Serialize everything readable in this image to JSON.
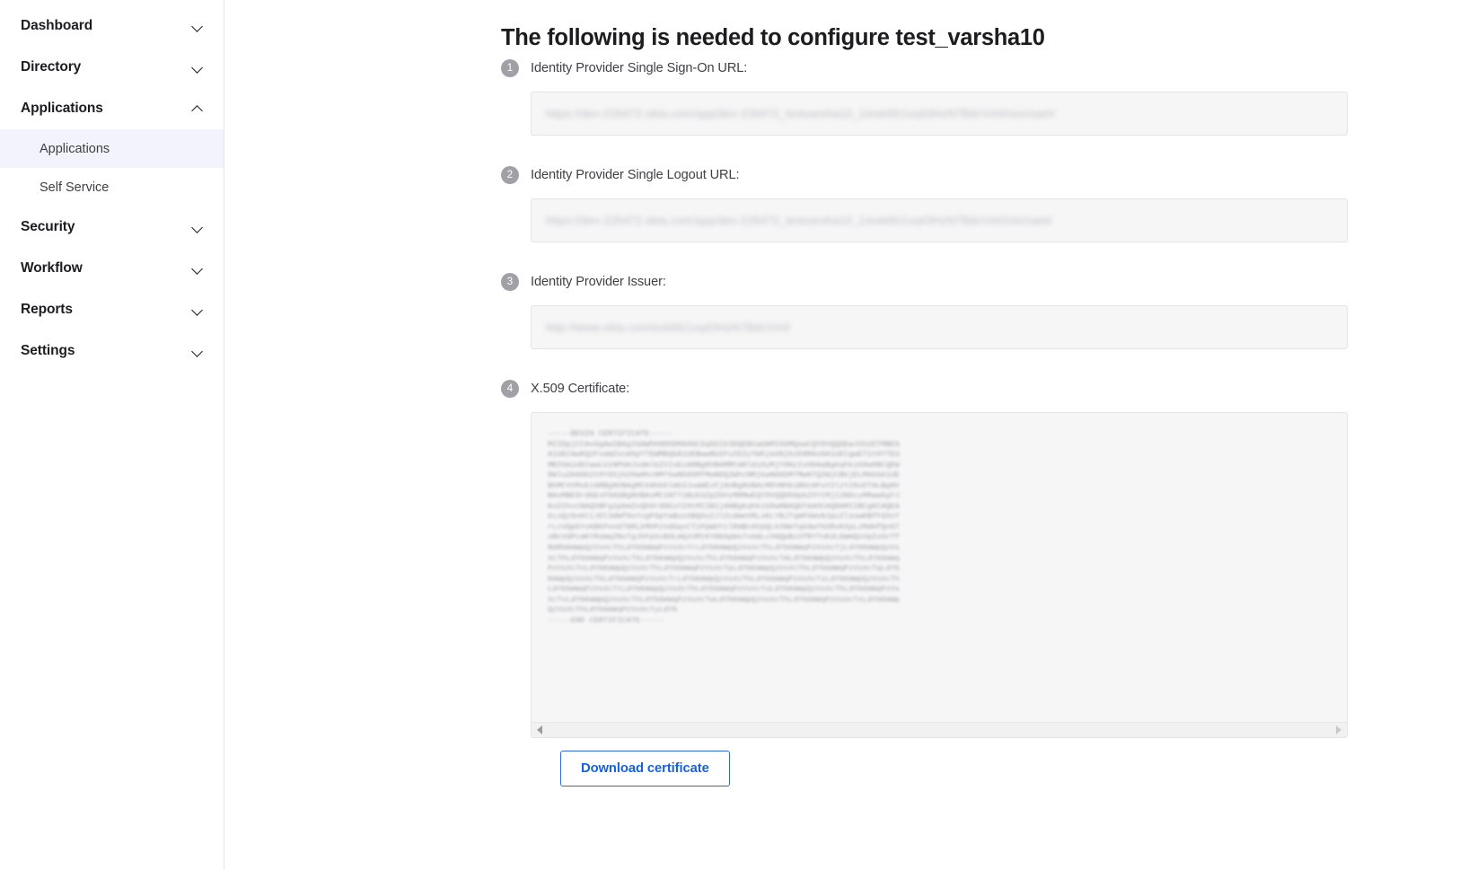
{
  "sidebar": {
    "groups": [
      {
        "label": "Dashboard",
        "icon": "chevron-down-icon",
        "expanded": false,
        "items": []
      },
      {
        "label": "Directory",
        "icon": "chevron-down-icon",
        "expanded": false,
        "items": []
      },
      {
        "label": "Applications",
        "icon": "chevron-up-icon",
        "expanded": true,
        "items": [
          {
            "label": "Applications",
            "active": true
          },
          {
            "label": "Self Service",
            "active": false
          }
        ]
      },
      {
        "label": "Security",
        "icon": "chevron-down-icon",
        "expanded": false,
        "items": []
      },
      {
        "label": "Workflow",
        "icon": "chevron-down-icon",
        "expanded": false,
        "items": []
      },
      {
        "label": "Reports",
        "icon": "chevron-down-icon",
        "expanded": false,
        "items": []
      },
      {
        "label": "Settings",
        "icon": "chevron-down-icon",
        "expanded": false,
        "items": []
      }
    ]
  },
  "main": {
    "title": "The following is needed to configure test_varsha10",
    "steps": [
      {
        "number": "1",
        "label": "Identity Provider Single Sign-On URL:",
        "value": "https://dev-226472.okta.com/app/dev-226472_testvarsha10_1/exk6fz1xq43HzN7BdcVm0/sso/saml"
      },
      {
        "number": "2",
        "label": "Identity Provider Single Logout URL:",
        "value": "https://dev-226472.okta.com/app/dev-226472_testvarsha10_1/exk6fz1xq43HzN7BdcVm0/slo/saml"
      },
      {
        "number": "3",
        "label": "Identity Provider Issuer:",
        "value": "http://www.okta.com/exk6fz1xq43HzN7BdcVm0"
      },
      {
        "number": "4",
        "label": "X.509 Certificate:",
        "certificate": "-----BEGIN CERTIFICATE-----\nMIIDpjCCAo6gAwIBAgIGAWhhNDhDMA0GCSqGSIb3DQEBCwUAMIGSMQswCQYDVQQGEwJVUzETMBEG\nA1UECAwKQ2FsaWZvcm5pYTEWMBQGA1UEBwwNU2FuIEZyYW5jaXNjbzENMAsGA1UECgwET2t0YTEU\nMBIGA1UECwwLU1NPUHJvdmlkZXIxEzARBgNVBAMMCmRldi0yMjY0NzIxHDAaBgkqhkiG9w0BCQEW\nDWluZm9Ab2t0YS5jb20wHhcNMTkwNDA5MTMwNDQ2WhcNMjkwNDA5MTMwNTQ2WjCBkjELMAkGA1UE\nBhMCVVMxEzARBgNVBAgMCkNhbGlmb3JuaWExFjAUBgNVBAcMDVNhbiBGcmFuY2lzY28xDTALBgNV\nBAoMBE9rdGExFDASBgNVBAsMC1NTT1Byb3ZpZGVyMRMwEQYDVQQDDApkZXYtMjI2NDcyMRwwGgYJ\nKoZIhvcNAQkBFg1pbmZvQG9rdGEuY29tMIIBIjANBgkqhkiG9w0BAQEFAAOCAQ8AMIIBCgKCAQEA\nkLnQz9xKCiJOl3dWf9sYvgPSpYaBuxXBQGvZJlZcdmeVRLxKLYBJTqmPXWvNJpcZlsnwKBfFdXnT\nrLcVQpbYvKBkPxnGTNRLkMhPzVdGqxCTzPpWUYzlRmBcHVpQLkXNmTqGdwYbSRvKXpLzMdHfQnGT\nxBcVdPLmKYRsWqZNvTgJhFpXcBdLmQzVRtKYNbGpWsTxHdLcVmQpBzXfRYTnKdLbWmQsVpZxGcTf\nNdRbKmWpQzVsXcThLdYbGmWqPzVsXcTrLdYbKmWpQzVsXcThLdYbGmWqPzVsXcTjLdYbKmWpQzVs\nXcThLdYbGmWqPzVsXcTkLdYbKmWpQzVsXcThLdYbGmWqPzVsXcTmLdYbKmWpQzVsXcThLdYbGmWq\nPzVsXcTnLdYbKmWpQzVsXcThLdYbGmWqPzVsXcTpLdYbKmWpQzVsXcThLdYbGmWqPzVsXcTqLdYb\nKmWpQzVsXcThLdYbGmWqPzVsXcTrLdYbKmWpQzVsXcThLdYbGmWqPzVsXcTsLdYbKmWpQzVsXcTh\nLdYbGmWqPzVsXcTtLdYbKmWpQzVsXcThLdYbGmWqPzVsXcTuLdYbKmWpQzVsXcThLdYbGmWqPzVs\nXcTvLdYbKmWpQzVsXcThLdYbGmWqPzVsXcTwLdYbKmWpQzVsXcThLdYbGmWqPzVsXcTxLdYbKmWp\nQzVsXcThLdYbGmWqPzVsXcTyLdYb\n-----END CERTIFICATE-----",
        "download_label": "Download certificate",
        "scrollbar": {
          "left_arrow": "scroll-left-arrow-icon",
          "right_arrow": "scroll-right-arrow-icon"
        }
      }
    ]
  },
  "colors": {
    "link_blue": "#1662dd",
    "button_border": "#2f6bd6",
    "active_nav_bg": "#f2f3fd",
    "badge_gray": "#9fa1a6",
    "field_bg": "#f6f6f7",
    "field_border": "#e3e4e8"
  }
}
